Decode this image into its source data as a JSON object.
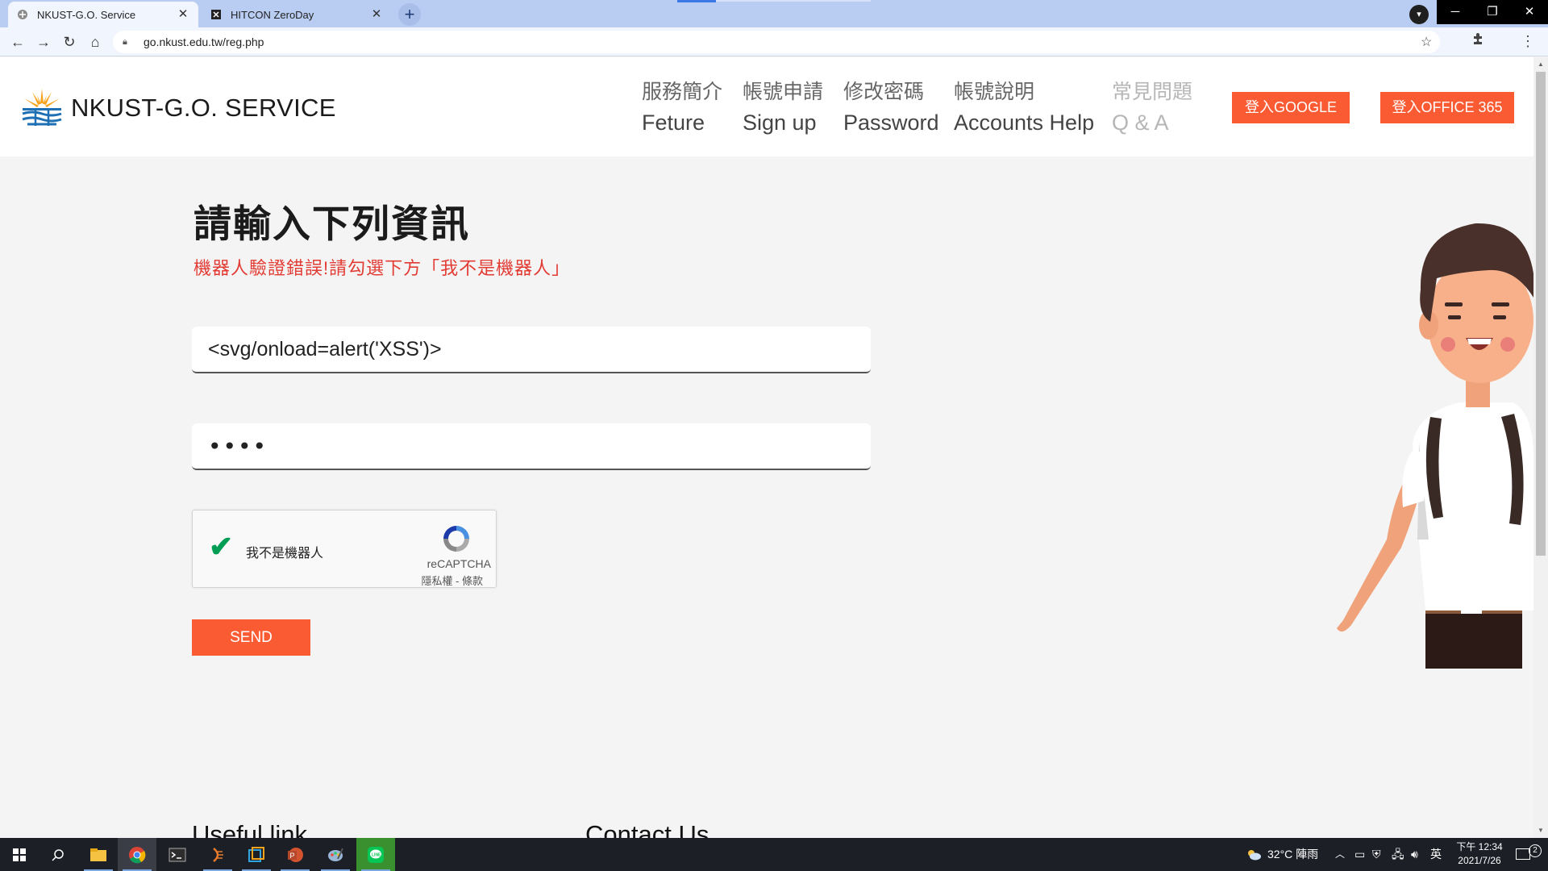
{
  "browser": {
    "tabs": [
      {
        "title": "NKUST-G.O. Service",
        "active": true
      },
      {
        "title": "HITCON ZeroDay",
        "active": false
      }
    ],
    "new_tab": "+",
    "url": "go.nkust.edu.tw/reg.php"
  },
  "header": {
    "brand": "NKUST-G.O. SERVICE",
    "nav": [
      {
        "zh": "服務簡介",
        "en": "Feture"
      },
      {
        "zh": "帳號申請",
        "en": "Sign up"
      },
      {
        "zh": "修改密碼",
        "en": "Password"
      },
      {
        "zh": "帳號說明",
        "en": "Accounts Help"
      },
      {
        "zh": "常見問題",
        "en": "Q & A"
      }
    ],
    "login_google": "登入GOOGLE",
    "login_office": "登入OFFICE 365"
  },
  "form": {
    "title": "請輸入下列資訊",
    "error": "機器人驗證錯誤!請勾選下方「我不是機器人」",
    "username_value": "<svg/onload=alert('XSS')>",
    "password_mask": "••••",
    "captcha": {
      "label": "我不是機器人",
      "brand": "reCAPTCHA",
      "privacy": "隱私權 - 條款"
    },
    "send": "SEND"
  },
  "footer": {
    "useful_link": "Useful link",
    "contact_us": "Contact Us"
  },
  "taskbar": {
    "weather": "32°C 陣雨",
    "ime": "英",
    "time_period": "下午 12:34",
    "date": "2021/7/26",
    "notifications": "2"
  },
  "colors": {
    "accent": "#fb5b33",
    "error": "#e23b33",
    "tabbar": "#b9cdf3"
  }
}
